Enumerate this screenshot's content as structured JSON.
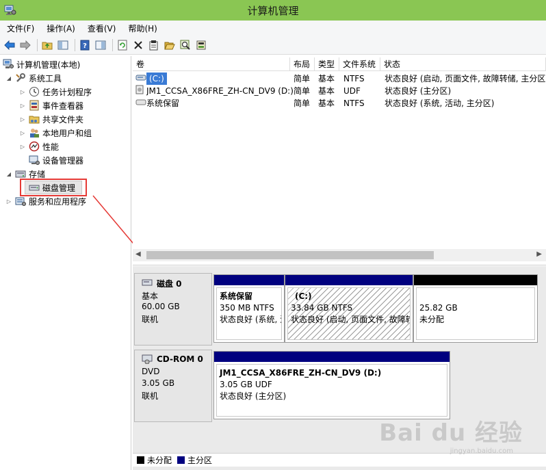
{
  "window": {
    "title": "计算机管理"
  },
  "menu": [
    "文件(F)",
    "操作(A)",
    "查看(V)",
    "帮助(H)"
  ],
  "toolbar_icons": [
    "back-arrow-icon",
    "forward-arrow-icon",
    "up-folder-icon",
    "show-tree-icon",
    "help-icon",
    "console-icon",
    "refresh-icon",
    "delete-icon",
    "properties-icon",
    "open-folder-icon",
    "search-icon",
    "export-icon"
  ],
  "tree": {
    "root": "计算机管理(本地)",
    "system_tools": "系统工具",
    "task_scheduler": "任务计划程序",
    "event_viewer": "事件查看器",
    "shared_folders": "共享文件夹",
    "local_users": "本地用户和组",
    "performance": "性能",
    "device_manager": "设备管理器",
    "storage": "存储",
    "disk_management": "磁盘管理",
    "services_apps": "服务和应用程序"
  },
  "volume_list": {
    "headers": [
      "卷",
      "布局",
      "类型",
      "文件系统",
      "状态"
    ],
    "rows": [
      {
        "volume": "(C:)",
        "layout": "简单",
        "type": "基本",
        "fs": "NTFS",
        "status": "状态良好 (启动, 页面文件, 故障转储, 主分区)"
      },
      {
        "volume": "JM1_CCSA_X86FRE_ZH-CN_DV9 (D:)",
        "layout": "简单",
        "type": "基本",
        "fs": "UDF",
        "status": "状态良好 (主分区)"
      },
      {
        "volume": "系统保留",
        "layout": "简单",
        "type": "基本",
        "fs": "NTFS",
        "status": "状态良好 (系统, 活动, 主分区)"
      }
    ]
  },
  "disks": [
    {
      "name": "磁盘 0",
      "kind": "基本",
      "size": "60.00 GB",
      "status": "联机",
      "partitions": [
        {
          "title": "系统保留",
          "size": "350 MB NTFS",
          "status": "状态良好 (系统, 活动, 主分区)",
          "bar_color": "#00007f"
        },
        {
          "title": "(C:)",
          "size": "33.84 GB NTFS",
          "status": "状态良好 (启动, 页面文件, 故障转储, 主分区)",
          "bar_color": "#00007f"
        },
        {
          "title": "",
          "size": "25.82 GB",
          "status": "未分配",
          "bar_color": "#000000"
        }
      ]
    },
    {
      "name": "CD-ROM 0",
      "kind": "DVD",
      "size": "3.05 GB",
      "status": "联机",
      "partitions": [
        {
          "title": "JM1_CCSA_X86FRE_ZH-CN_DV9  (D:)",
          "size": "3.05 GB UDF",
          "status": "状态良好 (主分区)",
          "bar_color": "#00007f"
        }
      ]
    }
  ],
  "legend": {
    "unallocated": "未分配",
    "primary": "主分区",
    "unallocated_color": "#000000",
    "primary_color": "#00007f"
  },
  "watermark": {
    "text": "Bai du 经验",
    "url": "jingyan.baidu.com"
  },
  "colors": {
    "titlebar": "#8ac653",
    "highlight": "#e53935"
  }
}
